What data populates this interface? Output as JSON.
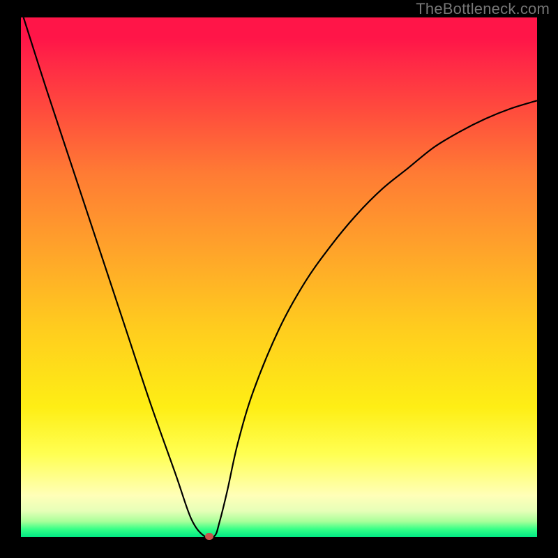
{
  "watermark": {
    "text": "TheBottleneck.com"
  },
  "colors": {
    "background": "#000000",
    "curve": "#000000",
    "marker": "#c9524c"
  },
  "chart_data": {
    "type": "line",
    "title": "",
    "xlabel": "",
    "ylabel": "",
    "xlim": [
      0,
      100
    ],
    "ylim": [
      0,
      100
    ],
    "grid": false,
    "legend": false,
    "series": [
      {
        "name": "curve",
        "x": [
          0.5,
          5,
          10,
          15,
          20,
          25,
          30,
          33,
          35.5,
          37.5,
          38.5,
          40,
          42,
          45,
          50,
          55,
          60,
          65,
          70,
          75,
          80,
          85,
          90,
          95,
          100
        ],
        "y": [
          100,
          86,
          71,
          56,
          41,
          26,
          12,
          3.5,
          0.2,
          0.2,
          3,
          9,
          18,
          28,
          40,
          49,
          56,
          62,
          67,
          71,
          75,
          78,
          80.5,
          82.5,
          84
        ]
      }
    ],
    "marker": {
      "x": 36.5,
      "y": 0.2
    }
  }
}
